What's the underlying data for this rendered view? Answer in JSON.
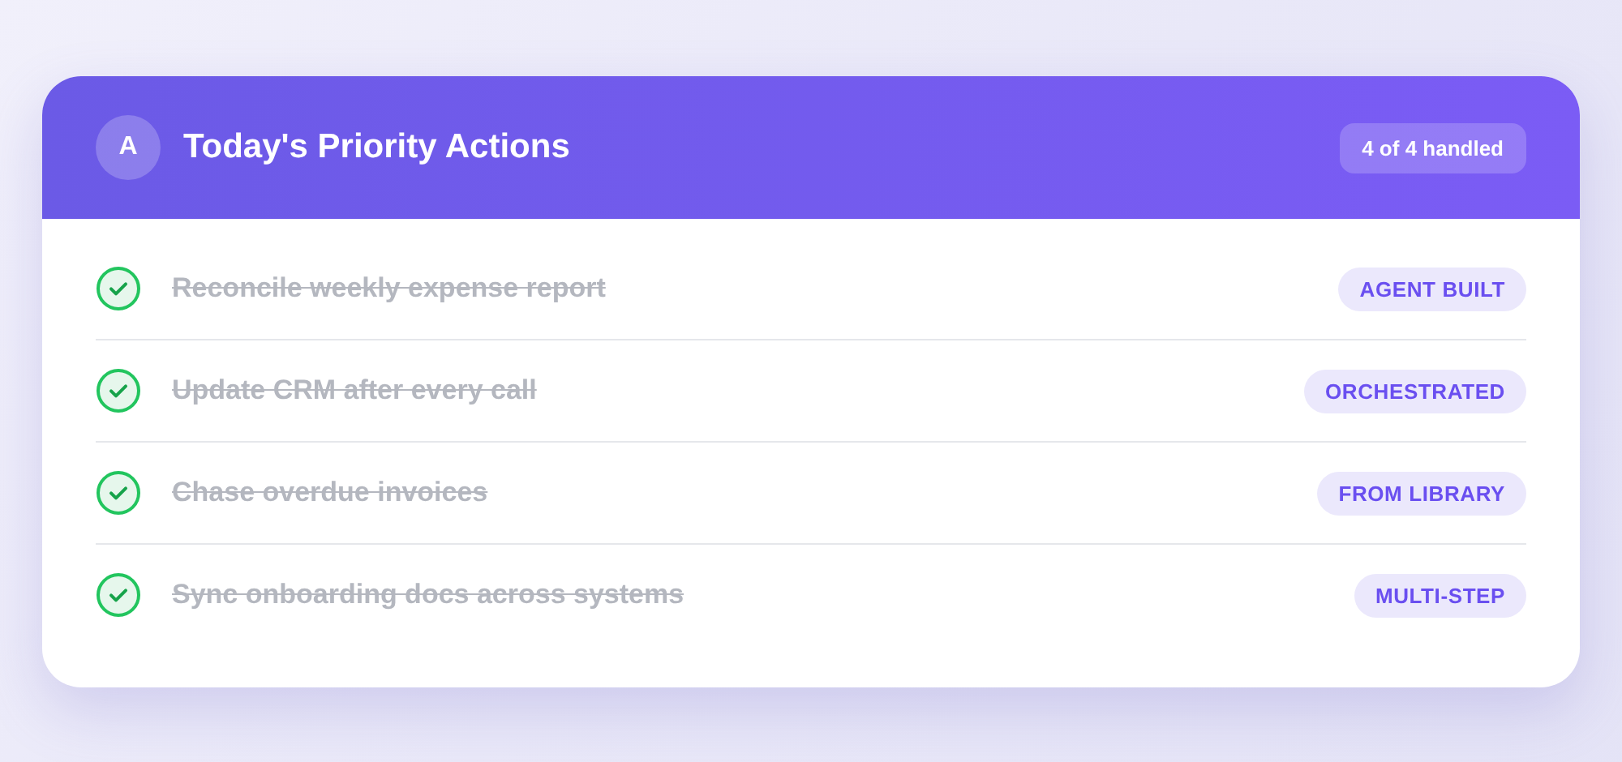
{
  "header": {
    "avatar": "A",
    "title": "Today's Priority Actions",
    "badge": "4 of 4 handled"
  },
  "tasks": [
    {
      "label": "Reconcile weekly expense report",
      "done": true,
      "tag": "AGENT BUILT"
    },
    {
      "label": "Update CRM after every call",
      "done": true,
      "tag": "ORCHESTRATED"
    },
    {
      "label": "Chase overdue invoices",
      "done": true,
      "tag": "FROM LIBRARY"
    },
    {
      "label": "Sync onboarding docs across systems",
      "done": true,
      "tag": "MULTI-STEP"
    }
  ]
}
